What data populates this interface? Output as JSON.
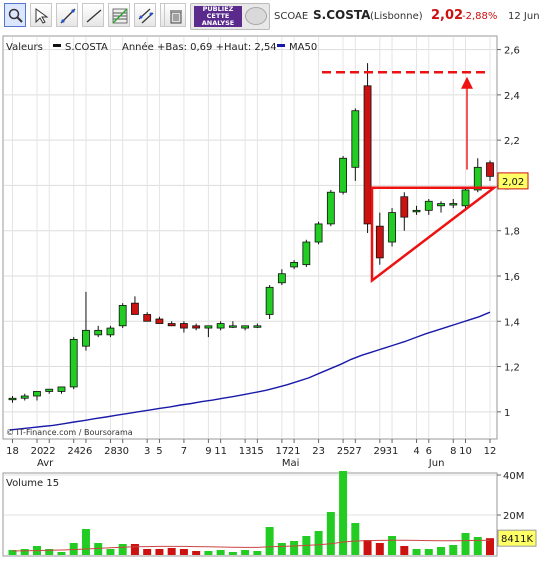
{
  "toolbar": {
    "tools": [
      {
        "icon": "zoom-icon",
        "active": true
      },
      {
        "icon": "cursor-icon",
        "active": false
      },
      {
        "icon": "trendline-icon",
        "active": false
      },
      {
        "icon": "line-icon",
        "active": false
      },
      {
        "icon": "fibonacci-icon",
        "active": false
      },
      {
        "icon": "channel-icon",
        "active": false
      },
      {
        "icon": "parallel-lines-icon",
        "active": false
      },
      {
        "icon": "trash-icon",
        "active": false
      }
    ],
    "promo": {
      "line1": "PUBLIEZ",
      "line2": "CETTE",
      "line3": "ANALYSE"
    }
  },
  "quote": {
    "code": "SCOAE",
    "name": "S.COSTA",
    "market": "(Lisbonne)",
    "price": "2,02",
    "change": "-2,88%",
    "date": "12 Jun"
  },
  "legend": {
    "label": "Valeurs",
    "series": "S.COSTA",
    "range": "Année +Bas: 0,69 +Haut: 2,54",
    "ma": "MA50"
  },
  "credit": "© IT-Finance.com / Boursorama",
  "volume_label": "Volume 15",
  "colors": {
    "up": "#22cc22",
    "down": "#cc1111",
    "ma": "#1a1aaa",
    "annotation": "#ee1111",
    "price_tag_border": "#cc1111"
  },
  "chart_data": [
    {
      "type": "candlestick",
      "x_tick_labels": [
        "18",
        "20",
        "22",
        "24",
        "26",
        "28",
        "30",
        "3",
        "5",
        "7",
        "9",
        "11",
        "13",
        "15",
        "17",
        "21",
        "23",
        "25",
        "27",
        "29",
        "31",
        "4",
        "6",
        "8",
        "10",
        "12"
      ],
      "month_labels": [
        "Avr",
        "Mai",
        "Jun"
      ],
      "y_ticks": [
        1,
        1.2,
        1.4,
        1.6,
        1.8,
        2,
        2.2,
        2.4,
        2.6
      ],
      "y_tick_labels": [
        "1",
        "1,2",
        "1,4",
        "1,6",
        "1,8",
        "2",
        "2,2",
        "2,4",
        "2,6"
      ],
      "ylim": [
        0.88,
        2.66
      ],
      "last_price_label": "2,02",
      "last_price": 2.02,
      "grid": true,
      "candles": [
        {
          "o": 1.06,
          "h": 1.07,
          "l": 1.04,
          "c": 1.06
        },
        {
          "o": 1.06,
          "h": 1.08,
          "l": 1.05,
          "c": 1.07
        },
        {
          "o": 1.07,
          "h": 1.09,
          "l": 1.05,
          "c": 1.09
        },
        {
          "o": 1.09,
          "h": 1.1,
          "l": 1.08,
          "c": 1.1
        },
        {
          "o": 1.09,
          "h": 1.11,
          "l": 1.08,
          "c": 1.11
        },
        {
          "o": 1.11,
          "h": 1.33,
          "l": 1.1,
          "c": 1.32
        },
        {
          "o": 1.29,
          "h": 1.53,
          "l": 1.27,
          "c": 1.36
        },
        {
          "o": 1.34,
          "h": 1.38,
          "l": 1.33,
          "c": 1.36
        },
        {
          "o": 1.34,
          "h": 1.38,
          "l": 1.33,
          "c": 1.37
        },
        {
          "o": 1.38,
          "h": 1.48,
          "l": 1.37,
          "c": 1.47
        },
        {
          "o": 1.48,
          "h": 1.51,
          "l": 1.43,
          "c": 1.43
        },
        {
          "o": 1.43,
          "h": 1.44,
          "l": 1.4,
          "c": 1.4
        },
        {
          "o": 1.41,
          "h": 1.42,
          "l": 1.39,
          "c": 1.39
        },
        {
          "o": 1.39,
          "h": 1.4,
          "l": 1.38,
          "c": 1.38
        },
        {
          "o": 1.39,
          "h": 1.4,
          "l": 1.35,
          "c": 1.37
        },
        {
          "o": 1.38,
          "h": 1.39,
          "l": 1.36,
          "c": 1.37
        },
        {
          "o": 1.37,
          "h": 1.38,
          "l": 1.33,
          "c": 1.38
        },
        {
          "o": 1.37,
          "h": 1.4,
          "l": 1.36,
          "c": 1.39
        },
        {
          "o": 1.38,
          "h": 1.4,
          "l": 1.37,
          "c": 1.38
        },
        {
          "o": 1.37,
          "h": 1.38,
          "l": 1.36,
          "c": 1.38
        },
        {
          "o": 1.38,
          "h": 1.39,
          "l": 1.37,
          "c": 1.38
        },
        {
          "o": 1.43,
          "h": 1.56,
          "l": 1.41,
          "c": 1.55
        },
        {
          "o": 1.57,
          "h": 1.63,
          "l": 1.56,
          "c": 1.61
        },
        {
          "o": 1.64,
          "h": 1.67,
          "l": 1.63,
          "c": 1.66
        },
        {
          "o": 1.65,
          "h": 1.76,
          "l": 1.64,
          "c": 1.75
        },
        {
          "o": 1.75,
          "h": 1.84,
          "l": 1.74,
          "c": 1.83
        },
        {
          "o": 1.83,
          "h": 1.98,
          "l": 1.82,
          "c": 1.97
        },
        {
          "o": 1.97,
          "h": 2.13,
          "l": 1.96,
          "c": 2.12
        },
        {
          "o": 2.08,
          "h": 2.34,
          "l": 2.02,
          "c": 2.33
        },
        {
          "o": 2.44,
          "h": 2.54,
          "l": 1.79,
          "c": 1.83
        },
        {
          "o": 1.82,
          "h": 1.88,
          "l": 1.65,
          "c": 1.68
        },
        {
          "o": 1.75,
          "h": 1.9,
          "l": 1.73,
          "c": 1.88
        },
        {
          "o": 1.95,
          "h": 1.97,
          "l": 1.8,
          "c": 1.86
        },
        {
          "o": 1.89,
          "h": 1.91,
          "l": 1.87,
          "c": 1.89
        },
        {
          "o": 1.89,
          "h": 1.94,
          "l": 1.87,
          "c": 1.93
        },
        {
          "o": 1.91,
          "h": 1.93,
          "l": 1.88,
          "c": 1.92
        },
        {
          "o": 1.92,
          "h": 1.94,
          "l": 1.9,
          "c": 1.92
        },
        {
          "o": 1.91,
          "h": 1.99,
          "l": 1.89,
          "c": 1.98
        },
        {
          "o": 1.98,
          "h": 2.12,
          "l": 1.97,
          "c": 2.08
        },
        {
          "o": 2.1,
          "h": 2.11,
          "l": 2.02,
          "c": 2.04
        }
      ],
      "ma50": [
        0.92,
        0.925,
        0.93,
        0.935,
        0.94,
        0.947,
        0.955,
        0.962,
        0.97,
        0.977,
        0.985,
        0.992,
        1.0,
        1.007,
        1.015,
        1.022,
        1.03,
        1.037,
        1.045,
        1.052,
        1.06,
        1.068,
        1.077,
        1.086,
        1.095,
        1.107,
        1.12,
        1.135,
        1.15,
        1.17,
        1.19,
        1.21,
        1.232,
        1.25,
        1.265,
        1.28,
        1.295,
        1.31,
        1.328,
        1.345,
        1.36,
        1.375,
        1.39,
        1.405,
        1.42,
        1.44
      ],
      "annotations": {
        "resistance_dashed": 2.5,
        "triangle": [
          [
            2.0,
            1.58
          ],
          [
            2.0,
            1.99
          ],
          [
            1.99,
            1.99
          ]
        ],
        "target_arrow": {
          "from": 2.07,
          "to": 2.48
        }
      }
    },
    {
      "type": "bar",
      "title": "Volume 15",
      "y_tick_labels": [
        "20M",
        "40M"
      ],
      "ylim": [
        0,
        40000000
      ],
      "last_value_label": "8411K",
      "volumes": [
        2500000,
        3000000,
        4500000,
        3000000,
        1500000,
        6000000,
        13000000,
        6000000,
        3000000,
        5500000,
        5500000,
        3000000,
        3000000,
        3500000,
        3000000,
        2000000,
        2000000,
        2500000,
        1500000,
        2500000,
        2000000,
        14000000,
        6000000,
        7000000,
        9500000,
        12000000,
        21500000,
        42000000,
        16000000,
        7500000,
        6000000,
        9500000,
        4500000,
        3000000,
        3000000,
        4000000,
        5000000,
        11000000,
        9000000,
        8411000
      ],
      "volume_ma": [
        2000000,
        2100000,
        2200000,
        2400000,
        2500000,
        2700000,
        3000000,
        3300000,
        3600000,
        3900000,
        4100000,
        4200000,
        4300000,
        4300000,
        4300000,
        4200000,
        4100000,
        4000000,
        3900000,
        3800000,
        3800000,
        4100000,
        4300000,
        4500000,
        4800000,
        5100000,
        5600000,
        6500000,
        7000000,
        7200000,
        7300000,
        7400000,
        7400000,
        7300000,
        7200000,
        7100000,
        7100000,
        7200000,
        7300000,
        7400000
      ]
    }
  ]
}
